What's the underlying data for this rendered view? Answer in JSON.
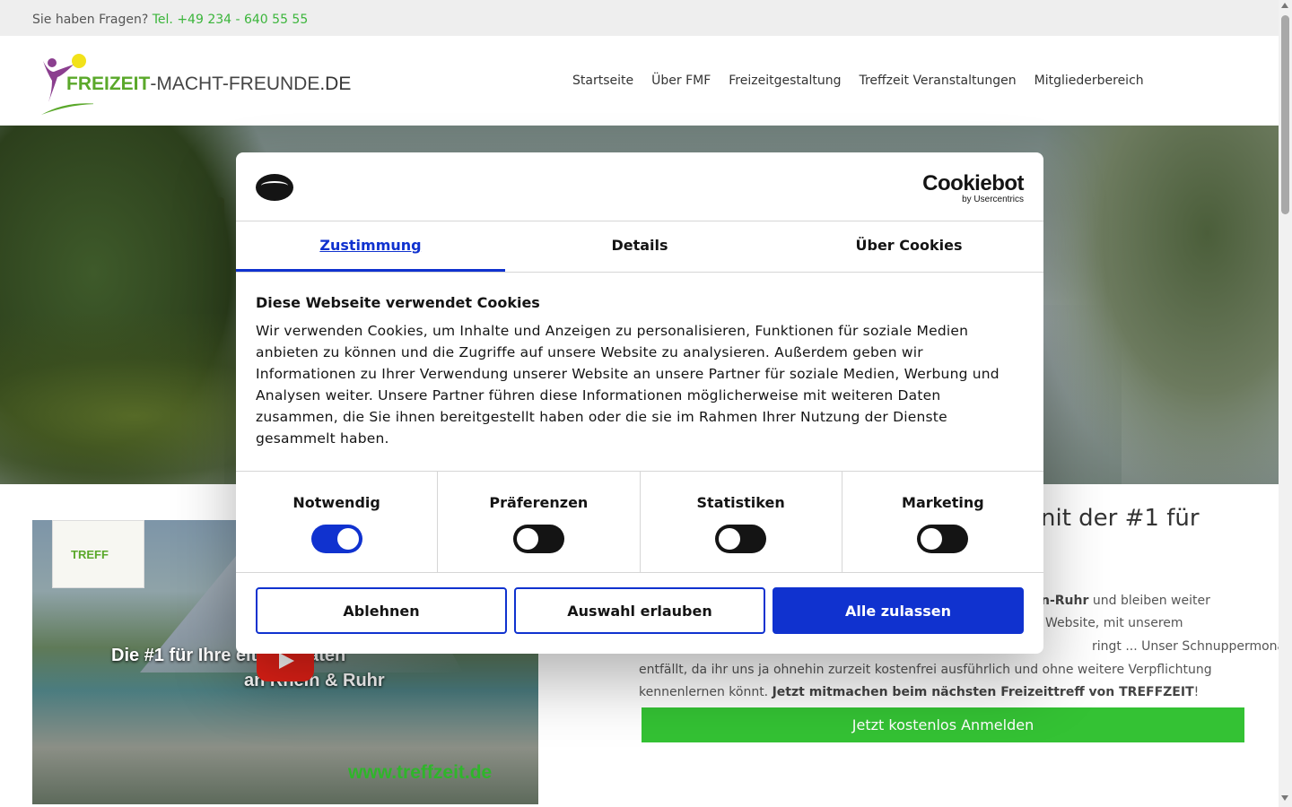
{
  "topbar": {
    "question": "Sie haben Fragen?",
    "phone": "Tel. +49 234 - 640 55 55"
  },
  "header": {
    "logo": {
      "part1": "FREIZEIT",
      "part2": "-MACHT-FREUNDE",
      "part3": ".DE"
    },
    "nav": [
      "Startseite",
      "Über FMF",
      "Freizeitgestaltung",
      "Treffzeit Veranstaltungen",
      "Mitgliederbereich"
    ]
  },
  "video": {
    "badge": "TREFF",
    "title_line1": "Die #1 für Ihre  eitaktivitäten",
    "title_line2": "an Rhein & Ruhr",
    "url": "www.treffzeit.de"
  },
  "main": {
    "headline_visible": "nit der #1 für",
    "para_line1_bold": "n-Ruhr",
    "para_line1_rest": " und bleiben weiter",
    "para_line2": "Website, mit unserem",
    "para_line3": "ringt ...   Unser Schnuppermonat",
    "para_line4": "entfällt, da ihr uns ja ohnehin zurzeit kostenfrei ausführlich und ohne weitere Verpflichtung",
    "para_line5_start": "kennenlernen könnt. ",
    "para_line5_bold": "Jetzt mitmachen beim nächsten Freizeittreff von TREFFZEIT",
    "para_line5_end": "!",
    "signup_button": "Jetzt kostenlos Anmelden"
  },
  "cookie_dialog": {
    "brand": "Cookiebot",
    "brand_by": "by Usercentrics",
    "tabs": [
      "Zustimmung",
      "Details",
      "Über Cookies"
    ],
    "active_tab": "Zustimmung",
    "heading": "Diese Webseite verwendet Cookies",
    "text": "Wir verwenden Cookies, um Inhalte und Anzeigen zu personalisieren, Funktionen für soziale Medien anbieten zu können und die Zugriffe auf unsere Website zu analysieren. Außerdem geben wir Informationen zu Ihrer Verwendung unserer Website an unsere Partner für soziale Medien, Werbung und Analysen weiter. Unsere Partner führen diese Informationen möglicherweise mit weiteren Daten zusammen, die Sie ihnen bereitgestellt haben oder die sie im Rahmen Ihrer Nutzung der Dienste gesammelt haben.",
    "categories": [
      {
        "label": "Notwendig",
        "checked": true
      },
      {
        "label": "Präferenzen",
        "checked": false
      },
      {
        "label": "Statistiken",
        "checked": false
      },
      {
        "label": "Marketing",
        "checked": false
      }
    ],
    "buttons": {
      "decline": "Ablehnen",
      "allow_selection": "Auswahl erlauben",
      "allow_all": "Alle zulassen"
    },
    "accent_color": "#1032cf"
  }
}
